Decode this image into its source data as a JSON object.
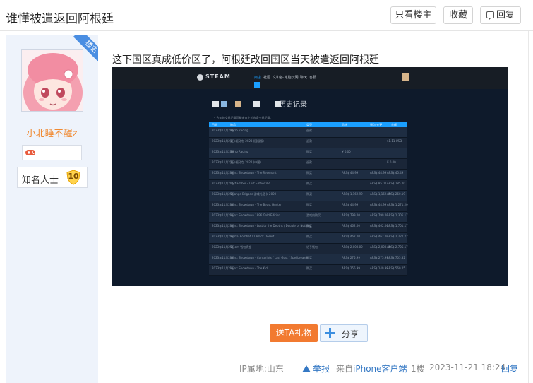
{
  "header": {
    "title": "谁懂被遣返回阿根廷",
    "only_op_label": "只看楼主",
    "favorite_label": "收藏",
    "reply_label": "回复"
  },
  "author": {
    "op_badge": "楼主",
    "username": "小北睡不醒z",
    "rank_title": "知名人士",
    "rank_level": "10"
  },
  "post": {
    "text": "这下国区真成低价区了，阿根廷改回国区当天被遣返回阿根廷"
  },
  "screenshot": {
    "logo": "STEAM",
    "nav": [
      "商店",
      "社区",
      "文和谷·电脑玩网",
      "聊天",
      "客服"
    ],
    "heading": "历史记录",
    "subtext": "• 今年的交易记录可能来自上的各条交易记录.",
    "columns": [
      "日期",
      "物品",
      "类型",
      "总计",
      "钱包 变更",
      "余额"
    ],
    "rows": [
      {
        "date": "2023年11月21日",
        "item": "Barro Racing",
        "type": "退款",
        "total": "",
        "change": "",
        "balance": ""
      },
      {
        "date": "2023年11月21日",
        "item": "显卡驱动包 2023 (国服版)",
        "type": "退款",
        "total": "",
        "change": "",
        "balance": "$1.11 USD"
      },
      {
        "date": "2023年11月21日",
        "item": "Barro Racing",
        "type": "购买",
        "total": "¥ 0.00",
        "change": "",
        "balance": ""
      },
      {
        "date": "2023年11月21日",
        "item": "显卡驱动包 2022 (中国)",
        "type": "退款",
        "total": "",
        "change": "",
        "balance": "¥ 0.00"
      },
      {
        "date": "2023年11月21日",
        "item": "Hunt: Showdown - The Revenant",
        "type": "购买",
        "total": "ARS$ 44.99",
        "change": "ARS$ 44.99",
        "balance": "ARS$ 45.49"
      },
      {
        "date": "2023年11月21日",
        "item": "Lost Ember - Lost Ember VR",
        "type": "购买",
        "total": "",
        "change": "ARS$ 85.00",
        "balance": "ARS$ 185.00"
      },
      {
        "date": "2023年11月21日",
        "item": "Strange Brigade 游戏礼品卡 2000",
        "type": "购买",
        "total": "ARS$ 1,169.99",
        "change": "ARS$ 1,169.99",
        "balance": "ARS$ 260.19"
      },
      {
        "date": "2023年11月21日",
        "item": "Hunt: Showdown - The Beast Hunter",
        "type": "购买",
        "total": "ARS$ 44.99",
        "change": "ARS$ 44.99",
        "balance": "ARS$ 1,271.20"
      },
      {
        "date": "2023年11月21日",
        "item": "Hunt: Showdown 1896 Gold Edition",
        "type": "游戏内购买",
        "total": "ARS$ 799.00",
        "change": "ARS$ 799.00",
        "balance": "ARS$ 1,305.17"
      },
      {
        "date": "2023年11月21日",
        "item": "Hunt: Showdown - Lost to the Depths / Double or Nothing",
        "type": "购买",
        "total": "ARS$ 462.00",
        "change": "ARS$ 462.00",
        "balance": "ARS$ 1,701.17"
      },
      {
        "date": "2023年11月21日",
        "item": "Mortal Kombat 11 Black Desert",
        "type": "购买",
        "total": "ARS$ 462.00",
        "change": "ARS$ 462.00",
        "balance": "ARS$ 2,222.22"
      },
      {
        "date": "2023年11月21日",
        "item": "Steam 钱包资金",
        "type": "给予钱包",
        "total": "ARS$ 2,000.00",
        "change": "ARS$ 2,000.00",
        "balance": "ARS$ 2,705.17"
      },
      {
        "date": "2023年11月21日",
        "item": "Hunt: Showdown - Conscripts / Last Gust / Spellbreaker",
        "type": "购买",
        "total": "ARS$ 275.99",
        "change": "ARS$ 275.99",
        "balance": "ARS$ 705.82"
      },
      {
        "date": "2023年11月21日",
        "item": "Hunt: Showdown - The Kid",
        "type": "购买",
        "total": "ARS$ 256.99",
        "change": "ARS$ 149.99",
        "balance": "ARS$ 560.25"
      }
    ]
  },
  "actions": {
    "gift_label": "送TA礼物",
    "share_label": "分享"
  },
  "footer": {
    "ip": "IP属地:山东",
    "report": "举报",
    "from_prefix": "来自",
    "from_device": "iPhone客户端",
    "floor": "1楼",
    "time": "2023-11-21 18:24",
    "reply": "回复"
  },
  "colors": {
    "accent_blue": "#3478c4",
    "gift_orange": "#f27a30",
    "username_orange": "#f08a32",
    "sidebar_bg": "#eef3fb",
    "steam_blue": "#1a9fff"
  }
}
